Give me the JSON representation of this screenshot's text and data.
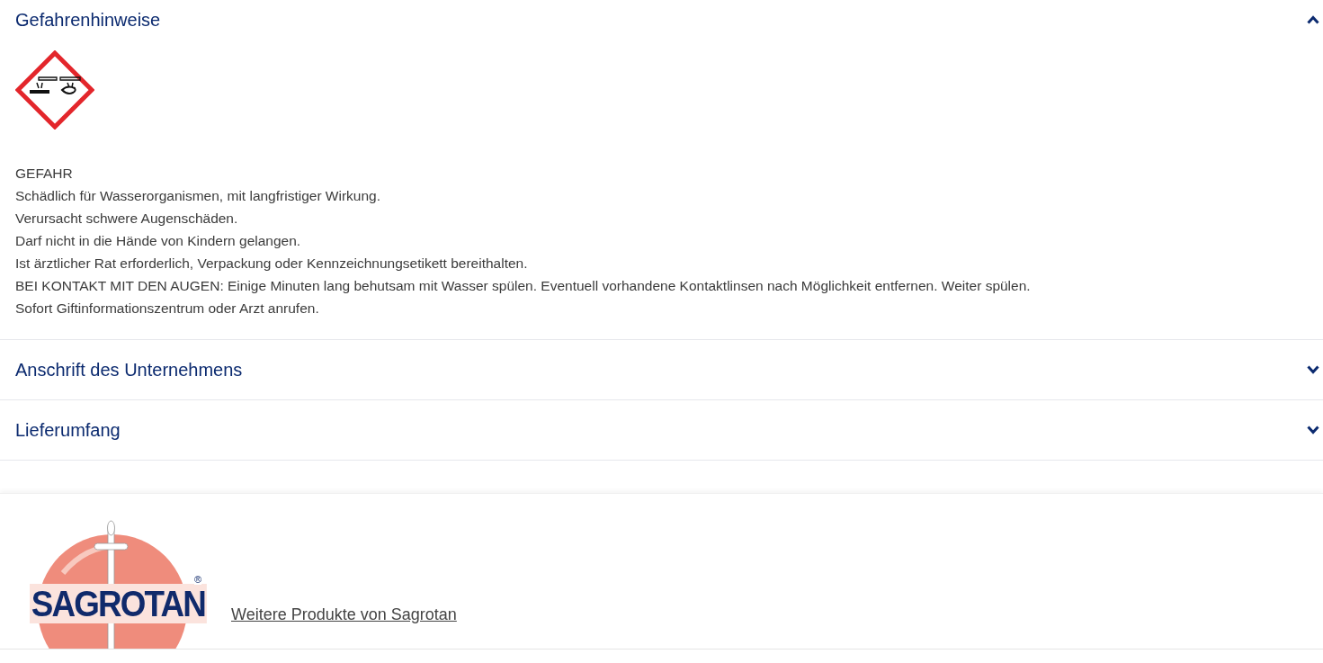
{
  "sections": [
    {
      "title": "Gefahrenhinweise",
      "expanded": true,
      "pictograms": [
        {
          "kind": "corrosive"
        }
      ],
      "lines": [
        "GEFAHR",
        "Schädlich für Wasserorganismen, mit langfristiger Wirkung.",
        "Verursacht schwere Augenschäden.",
        "Darf nicht in die Hände von Kindern gelangen.",
        "Ist ärztlicher Rat erforderlich, Verpackung oder Kennzeichnungsetikett bereithalten.",
        "BEI KONTAKT MIT DEN AUGEN: Einige Minuten lang behutsam mit Wasser spülen. Eventuell vorhandene Kontaktlinsen nach Möglichkeit entfernen. Weiter spülen.",
        "Sofort Giftinformationszentrum oder Arzt anrufen."
      ]
    },
    {
      "title": "Anschrift des Unternehmens",
      "expanded": false
    },
    {
      "title": "Lieferumfang",
      "expanded": false
    }
  ],
  "brand": {
    "logo_text": "SAGROTAN",
    "logo_mark": "®",
    "link": "Weitere Produkte von Sagrotan"
  }
}
